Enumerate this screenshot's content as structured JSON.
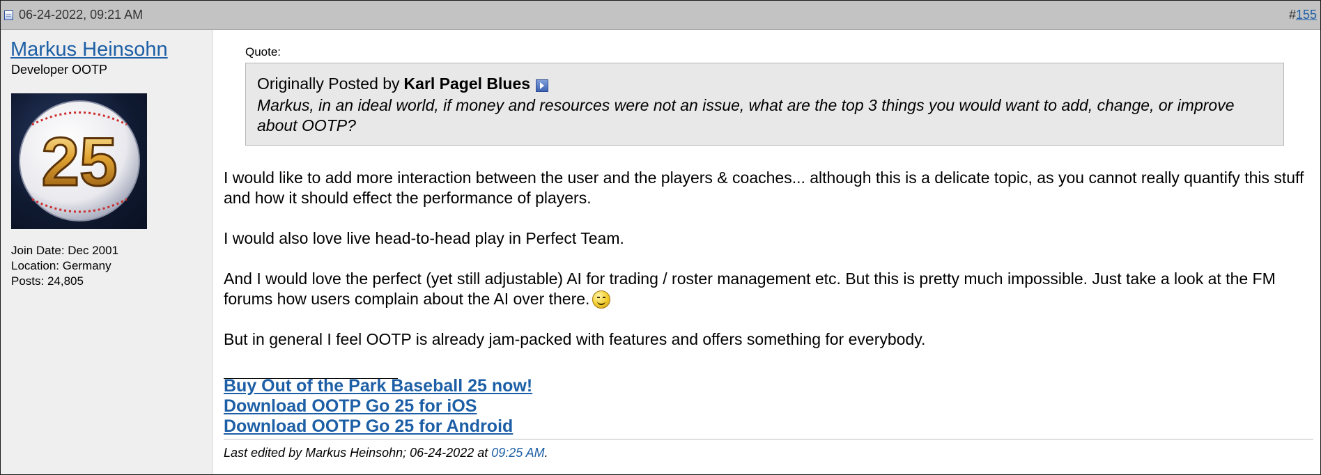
{
  "header": {
    "date": "06-24-2022, 09:21 AM",
    "post_hash": "#",
    "post_number": "155"
  },
  "user": {
    "name": "Markus Heinsohn",
    "title": "Developer OOTP",
    "avatar_text": "25",
    "join_date": "Join Date: Dec 2001",
    "location": "Location: Germany",
    "posts": "Posts: 24,805"
  },
  "quote": {
    "label": "Quote:",
    "prefix": "Originally Posted by",
    "author": "Karl Pagel Blues",
    "text": "Markus, in an ideal world, if money and resources were not an issue, what are the top 3 things you would want to add, change, or improve about OOTP?"
  },
  "body": {
    "p1": "I would like to add more interaction between the user and the players & coaches... although this is a delicate topic, as you cannot really quantify this stuff and how it should effect the performance of players.",
    "p2": "I would also love live head-to-head play in Perfect Team.",
    "p3": "And I would love the perfect (yet still adjustable) AI for trading / roster management etc. But this is pretty much impossible. Just take a look at the FM forums how users complain about the AI over there.",
    "p4": "But in general I feel OOTP is already jam-packed with features and offers something for everybody."
  },
  "signature": {
    "link1": "Buy Out of the Park Baseball 25 now!",
    "link2": "Download OOTP Go 25 for iOS",
    "link3": "Download OOTP Go 25 for Android"
  },
  "edit": {
    "prefix": "Last edited by Markus Heinsohn; 06-24-2022 at ",
    "time": "09:25 AM",
    "suffix": "."
  },
  "colors": {
    "header_bg": "#c3c3c3",
    "sidebar_bg": "#efefef",
    "quote_bg": "#e8e8e8",
    "link": "#1d5fa6"
  }
}
